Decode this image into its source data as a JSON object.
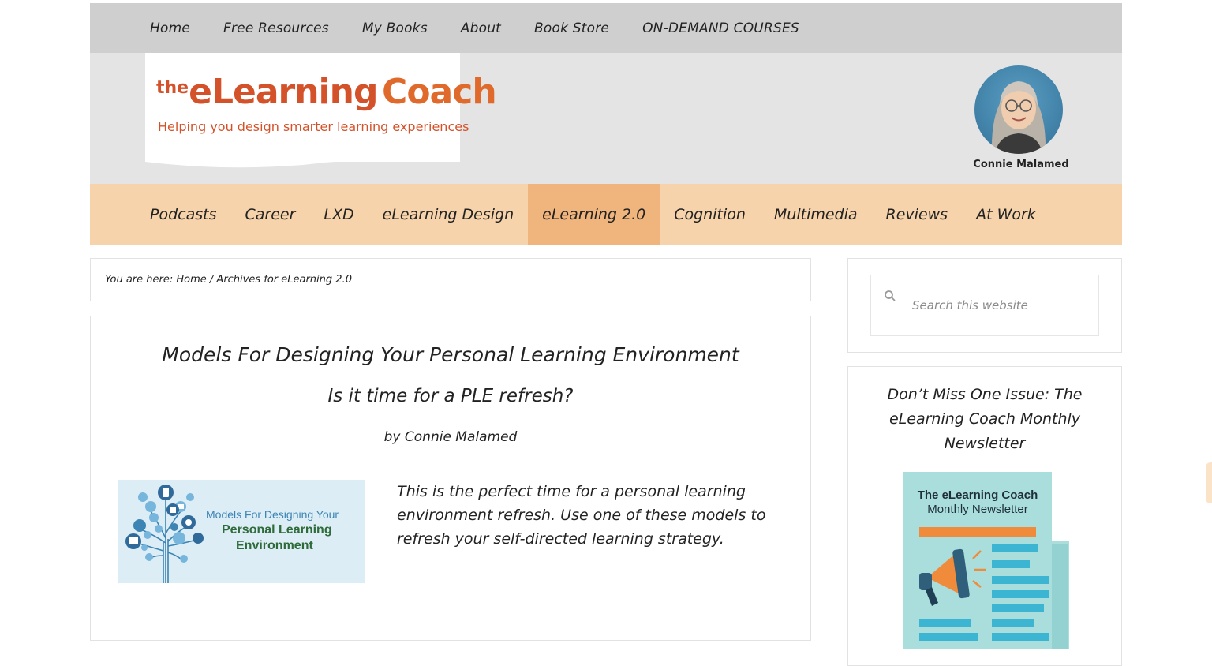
{
  "top_nav": [
    "Home",
    "Free Resources",
    "My Books",
    "About",
    "Book Store",
    "ON-DEMAND COURSES"
  ],
  "logo": {
    "the": "the",
    "elearning": "eLearning",
    "coach": "Coach",
    "tagline": "Helping you design smarter learning experiences"
  },
  "author": {
    "name": "Connie Malamed"
  },
  "category_nav": {
    "items": [
      "Podcasts",
      "Career",
      "LXD",
      "eLearning Design",
      "eLearning 2.0",
      "Cognition",
      "Multimedia",
      "Reviews",
      "At Work"
    ],
    "active": "eLearning 2.0"
  },
  "breadcrumb": {
    "prefix": "You are here: ",
    "home": "Home",
    "separator": " / ",
    "current": "Archives for eLearning 2.0"
  },
  "article": {
    "title": "Models For Designing Your Personal Learning Environment",
    "subtitle": "Is it time for a PLE refresh?",
    "byline": "by Connie Malamed",
    "thumb_line1": "Models For Designing Your",
    "thumb_line2": "Personal Learning",
    "thumb_line3": "Environment",
    "excerpt": "This is the perfect time for a personal learning environment refresh. Use one of these models to refresh your self-directed learning strategy."
  },
  "search": {
    "placeholder": "Search this website"
  },
  "newsletter": {
    "title": "Don’t Miss One Issue: The eLearning Coach Monthly Newsletter",
    "img_line1": "The eLearning Coach",
    "img_line2": "Monthly Newsletter"
  },
  "colors": {
    "top_nav_bg": "#cfcfcf",
    "header_bg": "#e4e4e4",
    "category_nav_bg": "#f6d3ab",
    "category_active_bg": "#f0b47d",
    "logo_orange": "#d4522a"
  }
}
